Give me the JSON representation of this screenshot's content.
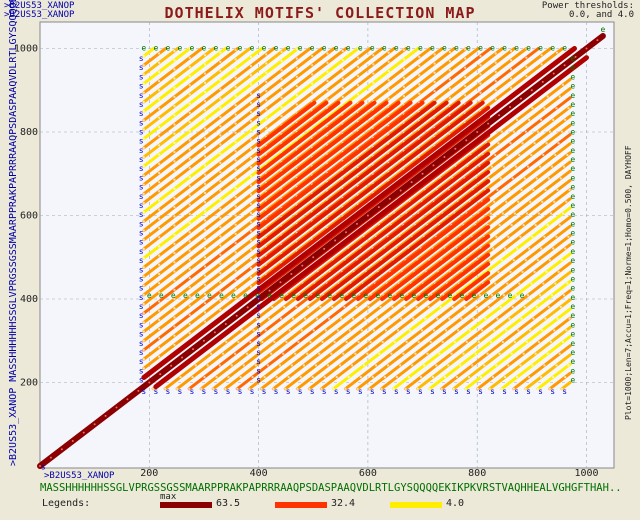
{
  "title": "DOTHELIX MOTIFS' COLLECTION MAP",
  "top_left_seq": ">B2US53_XANOP\n>B2US53_XANOP",
  "power_thresholds": "Power thresholds:\n0.0, and 4.0",
  "side_info": "Plot=1000;Len=7;Accu=1;Freq=1;Norme=1;Homo=0.500, DAYHOFF",
  "y_axis_seq_name": ">B2US53_XANOP",
  "y_axis_sequence": "MASSHHHHHHSSGLVPRGSSGSSMAARPPRAKPAPRRRAAQPSDASPAAQVDLRTLGYSQQQQEKIKP..",
  "x_axis_seq_name": ">B2US53_XANOP",
  "x_axis_sequence": "MASSHHHHHHSSGLVPRGSSGSSMAARPPRAKPAPRRRAAQPSDASPAAQVDLRTLGYSQQQQEKIKPKVRSTVAQHHEALVGHGFTHAH..",
  "legends_label": "Legends:",
  "legend_max_label": "max",
  "colors": {
    "dark": "#8b0000",
    "red": "#ff3300",
    "orange": "#ff9900",
    "yellow": "#ffee00"
  },
  "chart_data": {
    "type": "scatter",
    "title": "DOTHELIX MOTIFS' COLLECTION MAP",
    "xlim": [
      0,
      1040
    ],
    "ylim": [
      0,
      1040
    ],
    "x_ticks": [
      200,
      400,
      600,
      800,
      1000
    ],
    "y_ticks": [
      200,
      400,
      600,
      800,
      1000
    ],
    "grid": true,
    "legend": [
      {
        "value": "63.5",
        "color": "#8b0000"
      },
      {
        "value": "32.4",
        "color": "#ff3300"
      },
      {
        "value": "4.0",
        "color": "#ffee00"
      }
    ],
    "main_diagonal": {
      "from": [
        0,
        0
      ],
      "to": [
        1030,
        1030
      ]
    },
    "repeat_region": {
      "x": [
        190,
        970
      ],
      "y": [
        185,
        1000
      ]
    },
    "repeat_period": 22,
    "core_region": {
      "x": [
        400,
        820
      ],
      "y": [
        400,
        870
      ]
    },
    "parallel_offsets_strong": [
      -22,
      22
    ]
  }
}
